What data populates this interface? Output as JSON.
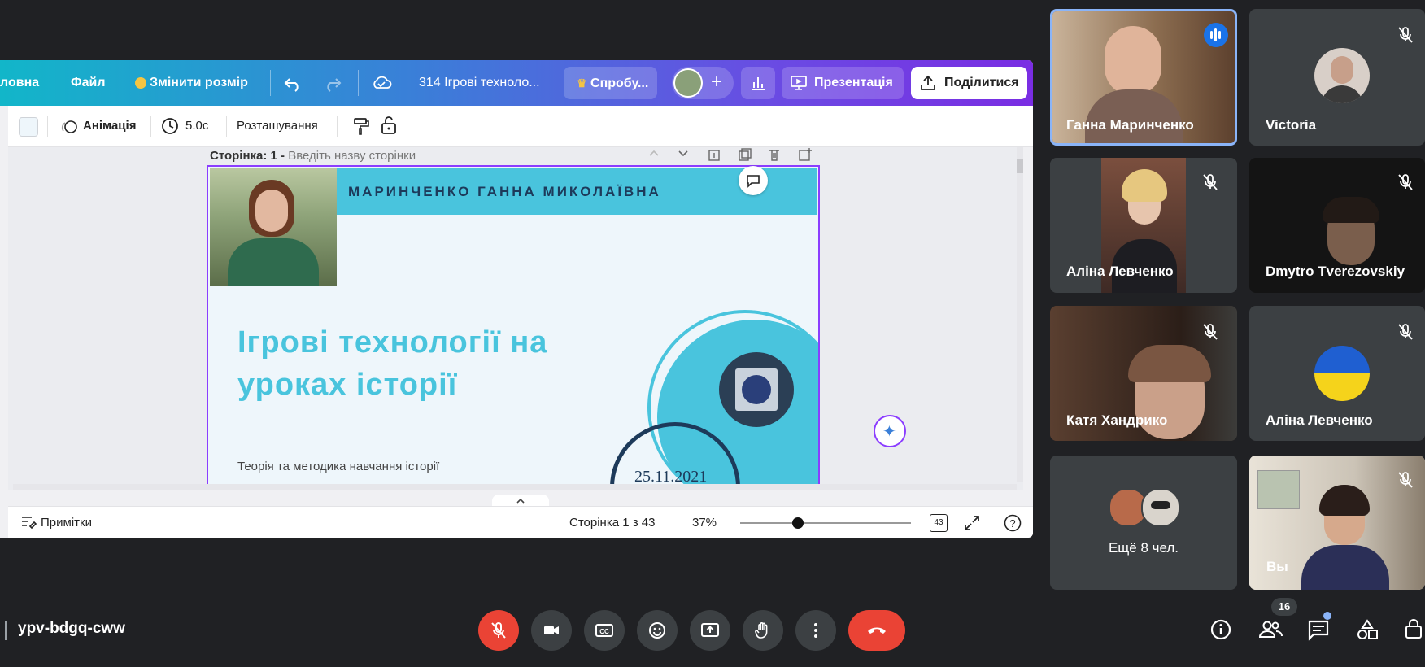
{
  "canva": {
    "topbar": {
      "home_label": "ловна",
      "file_label": "Файл",
      "resize_label": "Змінити розмір",
      "doc_title": "314 Ігрові техноло...",
      "try_label": "Спробу...",
      "present_label": "Презентація",
      "share_label": "Поділитися"
    },
    "toolbar": {
      "animation_label": "Анімація",
      "duration_label": "5.0с",
      "position_label": "Розташування"
    },
    "page_header": {
      "prefix": "Сторінка: 1 -",
      "placeholder": "Введіть назву сторінки"
    },
    "slide": {
      "name_band": "МАРИНЧЕНКО ГАННА МИКОЛАЇВНА",
      "title_line1": "Ігрові технології на",
      "title_line2": "уроках історії",
      "subtitle": "Теорія та методика навчання історії",
      "date": "25.11.2021"
    },
    "bottombar": {
      "notes_label": "Примітки",
      "page_indicator": "Сторінка 1 з 43",
      "zoom": "37%",
      "zoom_slider_fraction": 0.34,
      "pages_count": "43"
    }
  },
  "meeting": {
    "code": "ypv-bdgq-cww",
    "participant_count": "16",
    "participants": [
      {
        "name": "Ганна Маринченко",
        "speaking": true
      },
      {
        "name": "Victoria",
        "muted": true
      },
      {
        "name": "Аліна Левченко",
        "muted": true
      },
      {
        "name": "Dmytro Tverezovskiy",
        "muted": true
      },
      {
        "name": "Катя Хандрико",
        "muted": true
      },
      {
        "name": "Аліна Левченко",
        "muted": true
      },
      {
        "name": "Ещё 8 чел."
      },
      {
        "name": "Вы",
        "muted": true
      }
    ],
    "colors": {
      "end_call": "#ea4335",
      "mic_off": "#ea4335",
      "speaking_border": "#8ab4f8"
    }
  }
}
